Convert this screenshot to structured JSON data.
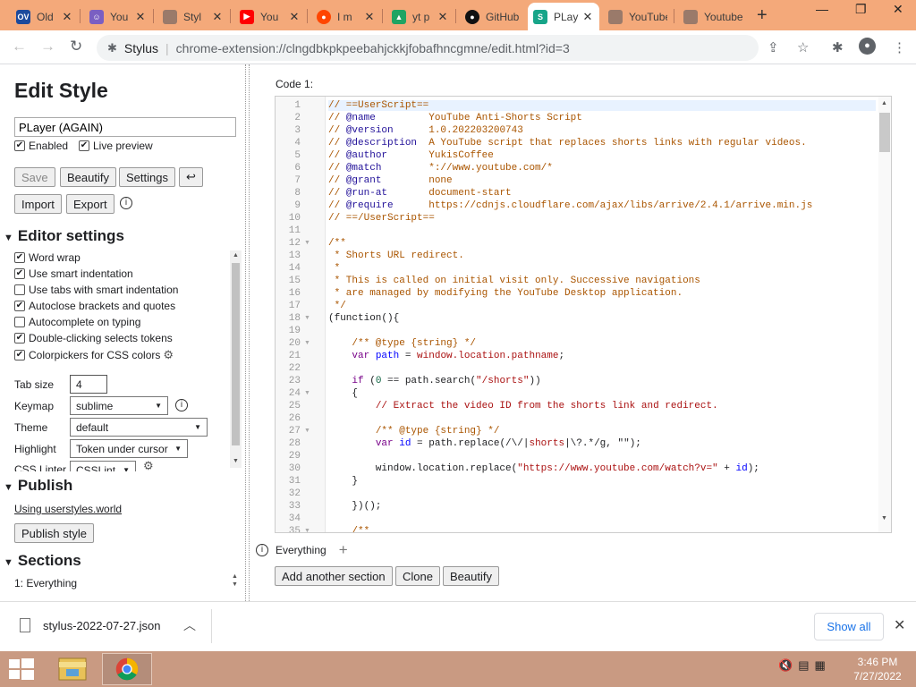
{
  "browser": {
    "tabs": [
      {
        "title": "Old",
        "icon": "ov-favicon",
        "color": "#1c4a9c",
        "glyph": "OV"
      },
      {
        "title": "You",
        "icon": "character-favicon",
        "color": "#7a5fc2",
        "glyph": "☺"
      },
      {
        "title": "Styl",
        "icon": "folder-favicon",
        "color": "#9a7a6a",
        "glyph": ""
      },
      {
        "title": "You",
        "icon": "youtube-favicon",
        "color": "#ff0000",
        "glyph": "▶"
      },
      {
        "title": "I m",
        "icon": "reddit-favicon",
        "color": "#ff4500",
        "glyph": "●"
      },
      {
        "title": "yt p",
        "icon": "drive-favicon",
        "color": "#1fa463",
        "glyph": "▲"
      },
      {
        "title": "GitHub",
        "icon": "github-favicon",
        "color": "#111111",
        "glyph": "●"
      },
      {
        "title": "PLay",
        "icon": "stylus-favicon",
        "color": "#17a589",
        "glyph": "S"
      },
      {
        "title": "YouTube",
        "icon": "folder-favicon",
        "color": "#9a7a6a",
        "glyph": ""
      },
      {
        "title": "Youtube",
        "icon": "folder-favicon",
        "color": "#9a7a6a",
        "glyph": ""
      }
    ],
    "close_glyph": "✕",
    "new_tab_glyph": "+",
    "omnibox": {
      "site": "Stylus",
      "separator": "|",
      "url": "chrome-extension://clngdbkpkpeebahjckkjfobafhncgmne/edit.html?id=3"
    }
  },
  "sidebar": {
    "title": "Edit Style",
    "style_name": "PLayer (AGAIN)",
    "enabled_label": "Enabled",
    "live_preview_label": "Live preview",
    "buttons": {
      "save": "Save",
      "beautify": "Beautify",
      "settings": "Settings",
      "undo": "↩",
      "import": "Import",
      "export": "Export"
    },
    "editor_settings": {
      "heading": "Editor settings",
      "options": [
        {
          "label": "Word wrap",
          "checked": true
        },
        {
          "label": "Use smart indentation",
          "checked": true
        },
        {
          "label": "Use tabs with smart indentation",
          "checked": false
        },
        {
          "label": "Autoclose brackets and quotes",
          "checked": true
        },
        {
          "label": "Autocomplete on typing",
          "checked": false
        },
        {
          "label": "Double-clicking selects tokens",
          "checked": true
        },
        {
          "label": "Colorpickers for CSS colors",
          "checked": true
        }
      ],
      "tab_size_label": "Tab size",
      "tab_size_value": "4",
      "keymap_label": "Keymap",
      "keymap_value": "sublime",
      "theme_label": "Theme",
      "theme_value": "default",
      "highlight_label": "Highlight",
      "highlight_value": "Token under cursor",
      "linter_label": "CSS Linter",
      "linter_value": "CSSLint"
    },
    "publish": {
      "heading": "Publish",
      "link": "Using userstyles.world",
      "button": "Publish style"
    },
    "sections": {
      "heading": "Sections",
      "items": [
        "1: Everything"
      ]
    }
  },
  "editor": {
    "label": "Code 1:",
    "line_numbers": [
      "1",
      "2",
      "3",
      "4",
      "5",
      "6",
      "7",
      "8",
      "9",
      "10",
      "11",
      "12",
      "13",
      "14",
      "15",
      "16",
      "17",
      "18",
      "19",
      "20",
      "21",
      "22",
      "23",
      "24",
      "25",
      "26",
      "27",
      "28",
      "29",
      "30",
      "31",
      "32",
      "33",
      "34",
      "35"
    ],
    "applies_label": "Everything",
    "buttons": {
      "add_section": "Add another section",
      "clone": "Clone",
      "beautify": "Beautify"
    }
  },
  "downloads": {
    "file": "stylus-2022-07-27.json",
    "show_all": "Show all"
  },
  "taskbar": {
    "time": "3:46 PM",
    "date": "7/27/2022"
  },
  "colors": {
    "tab_strip": "#f4a97a",
    "taskbar": "#c99a82",
    "comment": "#aa5500",
    "keyword": "#770088",
    "string": "#aa1111",
    "number": "#116644"
  }
}
